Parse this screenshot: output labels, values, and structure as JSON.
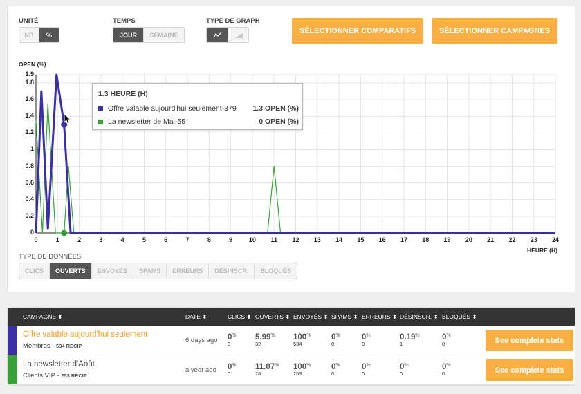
{
  "controls": {
    "unite_label": "UNITÉ",
    "unite_options": [
      "NB",
      "%"
    ],
    "temps_label": "TEMPS",
    "temps_options": [
      "JOUR",
      "SEMAINE"
    ],
    "graph_label": "TYPE DE GRAPH",
    "graph_icons": [
      "line-chart-icon",
      "area-chart-icon"
    ],
    "btn_comparatifs": "SÉLECTIONNER COMPARATIFS",
    "btn_campagnes": "SÉLECTIONNER CAMPAGNES"
  },
  "colors": {
    "series1": "#3a2fa3",
    "series2": "#3aa03a",
    "accent": "#f9b042"
  },
  "chart_data": {
    "type": "line",
    "ylabel": "OPEN (%)",
    "xlabel": "HEURE (H)",
    "ylim": [
      0,
      1.9
    ],
    "xlim": [
      0,
      24
    ],
    "y_ticks": [
      "1.9",
      "1.8",
      "1.6",
      "1.4",
      "1.2",
      "1",
      "0.8",
      "0.6",
      "0.4",
      "0.2",
      "0"
    ],
    "x_ticks": [
      "0",
      "1",
      "2",
      "3",
      "4",
      "5",
      "6",
      "7",
      "8",
      "9",
      "10",
      "11",
      "12",
      "13",
      "14",
      "15",
      "16",
      "17",
      "18",
      "19",
      "20",
      "21",
      "22",
      "23",
      "24"
    ],
    "series": [
      {
        "name": "Offre valable aujourd'hui seulement-379",
        "points": [
          [
            0,
            0
          ],
          [
            0.25,
            1.7
          ],
          [
            0.55,
            0.05
          ],
          [
            0.95,
            1.9
          ],
          [
            1.3,
            1.3
          ],
          [
            1.6,
            0
          ],
          [
            24,
            0
          ]
        ]
      },
      {
        "name": "La newsletter de Mai-55",
        "points": [
          [
            0,
            1.35
          ],
          [
            0.3,
            0
          ],
          [
            0.55,
            1.55
          ],
          [
            0.9,
            0
          ],
          [
            1.3,
            0
          ],
          [
            1.5,
            0.8
          ],
          [
            1.75,
            0
          ],
          [
            10.7,
            0
          ],
          [
            11.0,
            0.8
          ],
          [
            11.3,
            0
          ],
          [
            24,
            0
          ]
        ]
      }
    ],
    "tooltip": {
      "title": "1.3 HEURE (H)",
      "rows": [
        {
          "name": "Offre valable aujourd'hui seulement-379",
          "value": "1.3 OPEN (%)"
        },
        {
          "name": "La newsletter de Mai-55",
          "value": "0 OPEN (%)"
        }
      ]
    }
  },
  "data_types": {
    "label": "TYPE DE DONNÉES",
    "options": [
      "CLICS",
      "OUVERTS",
      "ENVOYÉS",
      "SPAMS",
      "ERREURS",
      "DÉSINSCR.",
      "BLOQUÉS"
    ]
  },
  "table": {
    "headers": {
      "campagne": "CAMPAGNE",
      "date": "DATE",
      "clics": "CLICS",
      "ouverts": "OUVERTS",
      "envoyes": "ENVOYÉS",
      "spams": "SPAMS",
      "erreurs": "ERREURS",
      "desinscr": "DÉSINSCR.",
      "bloques": "BLOQUÉS"
    },
    "rows": [
      {
        "name": "Offre valable aujourd'hui seulement",
        "list": "Membres",
        "recip": "534 RECIP",
        "date": "6 days ago",
        "clics": "0",
        "clics_n": "0",
        "ouverts": "5.99",
        "ouverts_n": "32",
        "envoyes": "100",
        "envoyes_n": "534",
        "spams": "0",
        "spams_n": "0",
        "erreurs": "0",
        "erreurs_n": "0",
        "desinscr": "0.19",
        "desinscr_n": "1",
        "bloques": "0",
        "bloques_n": "0",
        "button": "See complete stats"
      },
      {
        "name": "La newsletter d'Août",
        "list": "Clients VIP",
        "recip": "253 RECIP",
        "date": "a year ago",
        "clics": "0",
        "clics_n": "0",
        "ouverts": "11.07",
        "ouverts_n": "28",
        "envoyes": "100",
        "envoyes_n": "253",
        "spams": "0",
        "spams_n": "0",
        "erreurs": "0",
        "erreurs_n": "0",
        "desinscr": "0",
        "desinscr_n": "0",
        "bloques": "0",
        "bloques_n": "0",
        "button": "See complete stats"
      }
    ]
  }
}
